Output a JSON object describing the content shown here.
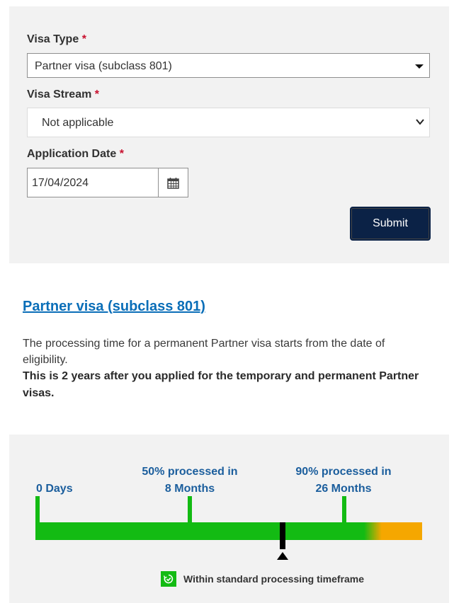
{
  "form": {
    "visa_type": {
      "label": "Visa Type",
      "required_mark": "*",
      "value": "Partner visa (subclass 801)"
    },
    "visa_stream": {
      "label": "Visa Stream",
      "required_mark": "*",
      "value": "Not applicable"
    },
    "application_date": {
      "label": "Application Date",
      "required_mark": "*",
      "value": "17/04/2024"
    },
    "submit_label": "Submit"
  },
  "result": {
    "title": "Partner visa (subclass 801)",
    "paragraph": "The processing time for a permanent Partner visa starts from the date of eligibility.",
    "emphasis": "This is 2 years after you applied for the temporary and permanent Partner visas."
  },
  "timeline": {
    "start_label": "0 Days",
    "p50_label_line1": "50% processed in",
    "p50_label_line2": "8 Months",
    "p90_label_line1": "90% processed in",
    "p90_label_line2": "26 Months",
    "status_text": "Within standard processing timeframe",
    "colors": {
      "within": "#13bb13",
      "beyond": "#f5a700",
      "marker": "#000000"
    }
  },
  "icons": {
    "calendar": "calendar-icon",
    "status": "clock-check-icon",
    "dropdown": "chevron-down-icon"
  }
}
